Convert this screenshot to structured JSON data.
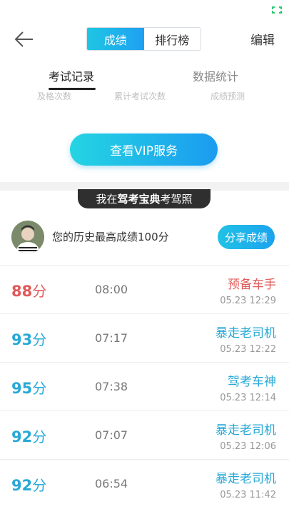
{
  "colors": {
    "accent": "#1fb0e8",
    "fail": "#e05a5a",
    "pass": "#28a9d6"
  },
  "top": {
    "seg_active": "成绩",
    "seg_inactive": "排行榜",
    "edit": "编辑"
  },
  "sub_tabs": [
    {
      "label": "考试记录"
    },
    {
      "label": "数据统计"
    }
  ],
  "stats": [
    "及格次数",
    "累计考试次数",
    "成绩预测"
  ],
  "vip": "查看VIP服务",
  "banner": {
    "pre": "我在",
    "bold": "驾考宝典",
    "post": "考驾照"
  },
  "best": "您的历史最高成绩100分",
  "share": "分享成绩",
  "records": [
    {
      "score": "88",
      "unit": "分",
      "duration": "08:00",
      "title": "预备车手",
      "date": "05.23  12:29",
      "status": "fail"
    },
    {
      "score": "93",
      "unit": "分",
      "duration": "07:17",
      "title": "暴走老司机",
      "date": "05.23  12:22",
      "status": "pass"
    },
    {
      "score": "95",
      "unit": "分",
      "duration": "07:38",
      "title": "驾考车神",
      "date": "05.23  12:14",
      "status": "pass"
    },
    {
      "score": "92",
      "unit": "分",
      "duration": "07:07",
      "title": "暴走老司机",
      "date": "05.23  12:06",
      "status": "pass"
    },
    {
      "score": "92",
      "unit": "分",
      "duration": "06:54",
      "title": "暴走老司机",
      "date": "05.23  11:42",
      "status": "pass"
    }
  ]
}
